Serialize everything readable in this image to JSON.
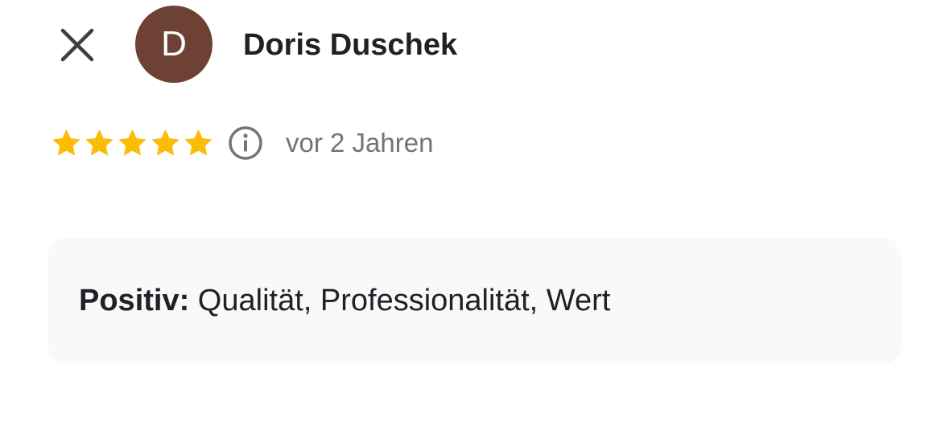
{
  "review": {
    "close_icon": "close-icon",
    "avatar": {
      "initial": "D",
      "color": "#6d4235"
    },
    "author_name": "Doris Duschek",
    "rating": 5,
    "rating_max": 5,
    "star_color": "#fbbc04",
    "info_icon": "info-icon",
    "time_ago": "vor 2 Jahren",
    "attributes": {
      "label": "Positiv:",
      "value": " Qualität, Professionalität, Wert"
    }
  }
}
